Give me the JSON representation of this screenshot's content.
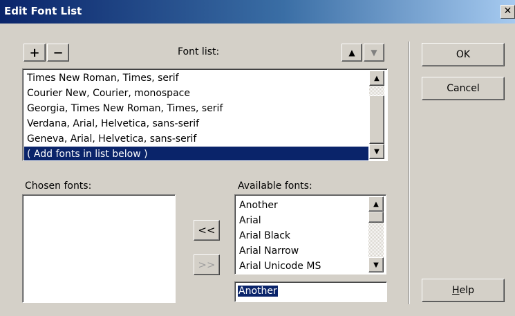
{
  "window": {
    "title": "Edit Font List",
    "close_label": "✕"
  },
  "toolbar": {
    "add_label": "+",
    "remove_label": "−",
    "up_label": "▲",
    "down_label": "▼"
  },
  "font_list": {
    "label": "Font list:",
    "items": [
      "Times New Roman, Times, serif",
      "Courier New, Courier, monospace",
      "Georgia, Times New Roman, Times, serif",
      "Verdana, Arial, Helvetica, sans-serif",
      "Geneva, Arial, Helvetica, sans-serif",
      "( Add fonts in list below )"
    ],
    "selected_index": 5
  },
  "chosen": {
    "label": "Chosen fonts:",
    "items": []
  },
  "available": {
    "label": "Available fonts:",
    "items": [
      "Another",
      "Arial",
      "Arial Black",
      "Arial Narrow",
      "Arial Unicode MS"
    ],
    "input_value": "Another"
  },
  "move": {
    "add_label": "<<",
    "remove_label": ">>"
  },
  "buttons": {
    "ok": "OK",
    "cancel": "Cancel",
    "help_mnemonic": "H",
    "help_rest": "elp"
  }
}
